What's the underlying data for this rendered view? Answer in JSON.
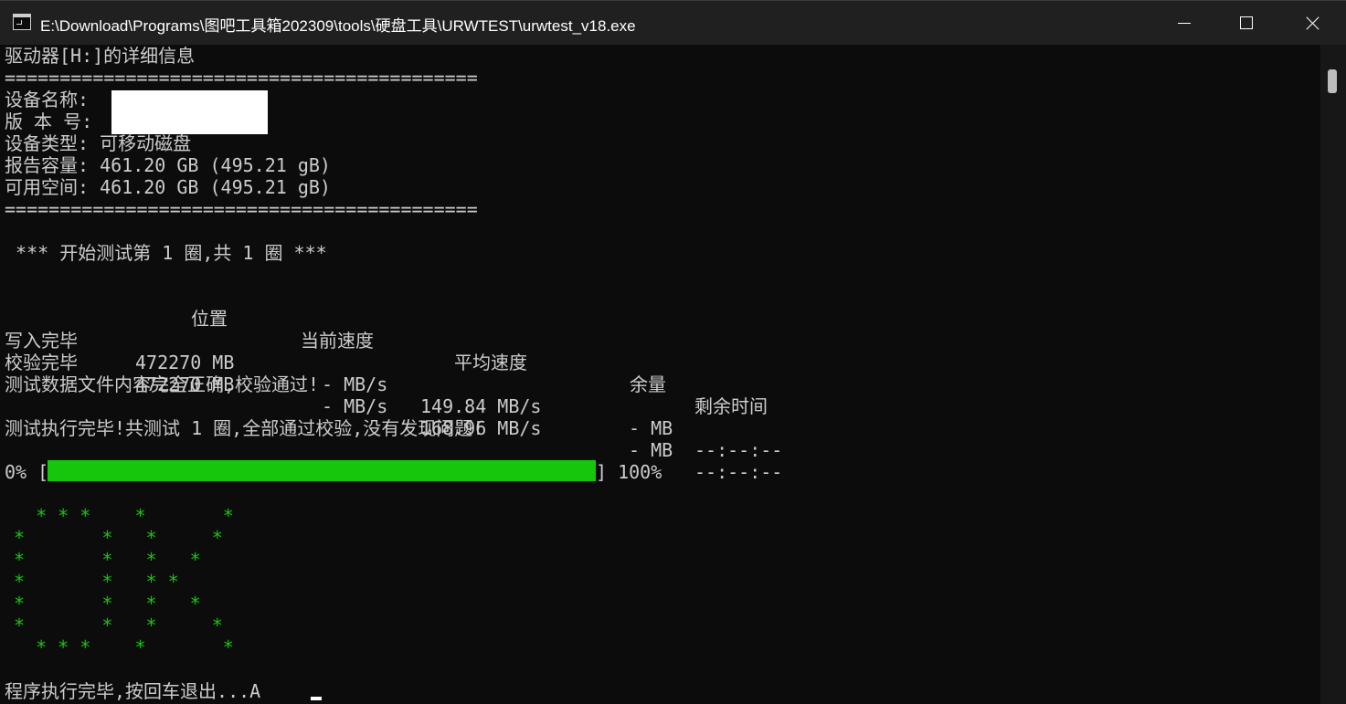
{
  "window": {
    "title": "E:\\Download\\Programs\\图吧工具箱202309\\tools\\硬盘工具\\URWTEST\\urwtest_v18.exe"
  },
  "console": {
    "header": "驱动器[H:]的详细信息",
    "separator": "===========================================",
    "device_name_label": "设备名称:",
    "version_label": "版 本 号:",
    "device_type_line": "设备类型: 可移动磁盘",
    "reported_capacity_line": "报告容量: 461.20 GB (495.21 gB)",
    "free_space_line": "可用空间: 461.20 GB (495.21 gB)",
    "test_start": " *** 开始测试第 1 圈,共 1 圈 ***",
    "table": {
      "headers": [
        "位置",
        "当前速度",
        "平均速度",
        "余量",
        "剩余时间"
      ],
      "rows": [
        [
          "写入完毕",
          "472270 MB",
          "- MB/s",
          "149.84 MB/s",
          "- MB",
          "--:--:--"
        ],
        [
          "校验完毕",
          "472270 MB",
          "- MB/s",
          "168.96 MB/s",
          "- MB",
          "--:--:--"
        ]
      ]
    },
    "verify_message": "测试数据文件内容完全正确,校验通过!",
    "done_message": "测试执行完毕!共测试 1 圈,全部通过校验,没有发现问题!",
    "progress": {
      "start_label": "0% [",
      "end_label": "] 100%",
      "percent": 100
    },
    "ok_art": [
      "  * * *    *       *",
      "*       *   *     *",
      "*       *   *   *",
      "*       *   * *",
      "*       *   *   *",
      "*       *   *     *",
      "  * * *    *       *"
    ],
    "exit_prompt": "程序执行完毕,按回车退出...A"
  },
  "colors": {
    "console_bg": "#0c0c0c",
    "console_fg": "#cccccc",
    "progress_green": "#16c60c",
    "titlebar_bg": "#202020"
  }
}
